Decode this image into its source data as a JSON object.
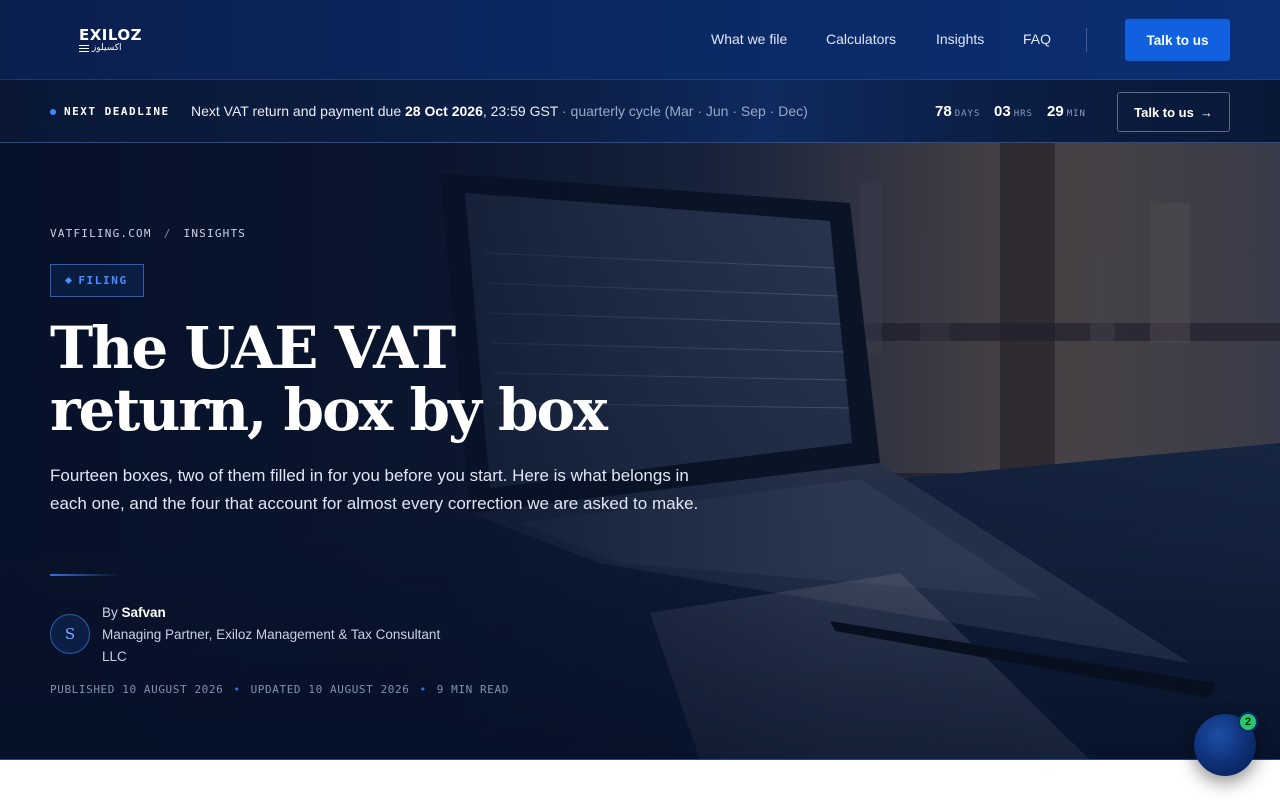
{
  "header": {
    "logo": {
      "name": "EXILOZ",
      "arabic": "اكسيلوز"
    },
    "nav": [
      {
        "label": "What we file"
      },
      {
        "label": "Calculators"
      },
      {
        "label": "Insights"
      },
      {
        "label": "FAQ"
      }
    ],
    "cta_label": "Talk to us"
  },
  "deadline_bar": {
    "label": "NEXT DEADLINE",
    "message_pre": "Next VAT return and payment due ",
    "message_date": "28 Oct 2026",
    "message_time": ", 23:59 GST",
    "message_cycle": " · quarterly cycle (Mar · Jun · Sep · Dec)",
    "countdown": {
      "days": "78",
      "days_unit": "DAYS",
      "hours": "03",
      "hours_unit": "HRS",
      "minutes": "29",
      "minutes_unit": "MIN"
    },
    "cta_label": "Talk to us",
    "cta_arrow": "→"
  },
  "hero": {
    "breadcrumb": {
      "home": "VATFILING.COM",
      "sep": "/",
      "section": "INSIGHTS"
    },
    "tag": "FILING",
    "title": "The UAE VAT return, box by box",
    "lead": "Fourteen boxes, two of them filled in for you before you start. Here is what belongs in each one, and the four that account for almost every correction we are asked to make.",
    "author": {
      "initial": "S",
      "by": "By ",
      "name": "Safvan",
      "role": "Managing Partner, Exiloz Management & Tax Consultant LLC"
    },
    "meta": {
      "published": "PUBLISHED 10 AUGUST 2026",
      "updated": "UPDATED 10 AUGUST 2026",
      "read_time": "9 MIN READ",
      "dot": "•"
    }
  },
  "chat": {
    "badge_count": "2",
    "icon": "chat-icon"
  },
  "colors": {
    "accent": "#1060e0",
    "tag": "#4a8cff",
    "chat_badge": "#2ac769",
    "navy": "#0b1f4d"
  }
}
